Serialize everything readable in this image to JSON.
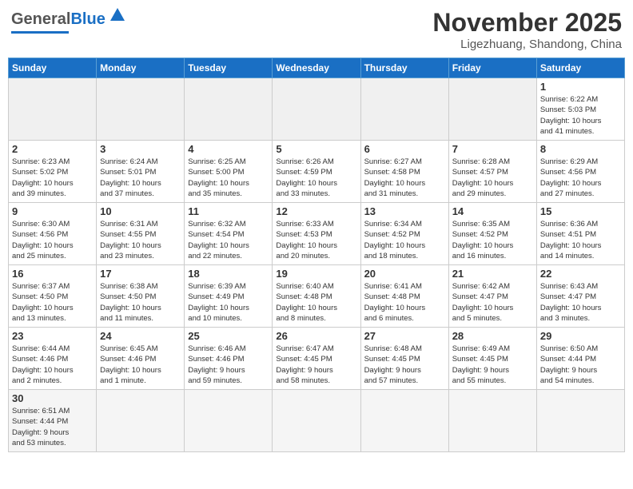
{
  "logo": {
    "text1": "General",
    "text2": "Blue"
  },
  "title": "November 2025",
  "location": "Ligezhuang, Shandong, China",
  "weekdays": [
    "Sunday",
    "Monday",
    "Tuesday",
    "Wednesday",
    "Thursday",
    "Friday",
    "Saturday"
  ],
  "days": [
    {
      "number": "",
      "info": "",
      "empty": true
    },
    {
      "number": "",
      "info": "",
      "empty": true
    },
    {
      "number": "",
      "info": "",
      "empty": true
    },
    {
      "number": "",
      "info": "",
      "empty": true
    },
    {
      "number": "",
      "info": "",
      "empty": true
    },
    {
      "number": "",
      "info": "",
      "empty": true
    },
    {
      "number": "1",
      "info": "Sunrise: 6:22 AM\nSunset: 5:03 PM\nDaylight: 10 hours\nand 41 minutes.",
      "empty": false
    }
  ],
  "week2": [
    {
      "number": "2",
      "info": "Sunrise: 6:23 AM\nSunset: 5:02 PM\nDaylight: 10 hours\nand 39 minutes."
    },
    {
      "number": "3",
      "info": "Sunrise: 6:24 AM\nSunset: 5:01 PM\nDaylight: 10 hours\nand 37 minutes."
    },
    {
      "number": "4",
      "info": "Sunrise: 6:25 AM\nSunset: 5:00 PM\nDaylight: 10 hours\nand 35 minutes."
    },
    {
      "number": "5",
      "info": "Sunrise: 6:26 AM\nSunset: 4:59 PM\nDaylight: 10 hours\nand 33 minutes."
    },
    {
      "number": "6",
      "info": "Sunrise: 6:27 AM\nSunset: 4:58 PM\nDaylight: 10 hours\nand 31 minutes."
    },
    {
      "number": "7",
      "info": "Sunrise: 6:28 AM\nSunset: 4:57 PM\nDaylight: 10 hours\nand 29 minutes."
    },
    {
      "number": "8",
      "info": "Sunrise: 6:29 AM\nSunset: 4:56 PM\nDaylight: 10 hours\nand 27 minutes."
    }
  ],
  "week3": [
    {
      "number": "9",
      "info": "Sunrise: 6:30 AM\nSunset: 4:56 PM\nDaylight: 10 hours\nand 25 minutes."
    },
    {
      "number": "10",
      "info": "Sunrise: 6:31 AM\nSunset: 4:55 PM\nDaylight: 10 hours\nand 23 minutes."
    },
    {
      "number": "11",
      "info": "Sunrise: 6:32 AM\nSunset: 4:54 PM\nDaylight: 10 hours\nand 22 minutes."
    },
    {
      "number": "12",
      "info": "Sunrise: 6:33 AM\nSunset: 4:53 PM\nDaylight: 10 hours\nand 20 minutes."
    },
    {
      "number": "13",
      "info": "Sunrise: 6:34 AM\nSunset: 4:52 PM\nDaylight: 10 hours\nand 18 minutes."
    },
    {
      "number": "14",
      "info": "Sunrise: 6:35 AM\nSunset: 4:52 PM\nDaylight: 10 hours\nand 16 minutes."
    },
    {
      "number": "15",
      "info": "Sunrise: 6:36 AM\nSunset: 4:51 PM\nDaylight: 10 hours\nand 14 minutes."
    }
  ],
  "week4": [
    {
      "number": "16",
      "info": "Sunrise: 6:37 AM\nSunset: 4:50 PM\nDaylight: 10 hours\nand 13 minutes."
    },
    {
      "number": "17",
      "info": "Sunrise: 6:38 AM\nSunset: 4:50 PM\nDaylight: 10 hours\nand 11 minutes."
    },
    {
      "number": "18",
      "info": "Sunrise: 6:39 AM\nSunset: 4:49 PM\nDaylight: 10 hours\nand 10 minutes."
    },
    {
      "number": "19",
      "info": "Sunrise: 6:40 AM\nSunset: 4:48 PM\nDaylight: 10 hours\nand 8 minutes."
    },
    {
      "number": "20",
      "info": "Sunrise: 6:41 AM\nSunset: 4:48 PM\nDaylight: 10 hours\nand 6 minutes."
    },
    {
      "number": "21",
      "info": "Sunrise: 6:42 AM\nSunset: 4:47 PM\nDaylight: 10 hours\nand 5 minutes."
    },
    {
      "number": "22",
      "info": "Sunrise: 6:43 AM\nSunset: 4:47 PM\nDaylight: 10 hours\nand 3 minutes."
    }
  ],
  "week5": [
    {
      "number": "23",
      "info": "Sunrise: 6:44 AM\nSunset: 4:46 PM\nDaylight: 10 hours\nand 2 minutes."
    },
    {
      "number": "24",
      "info": "Sunrise: 6:45 AM\nSunset: 4:46 PM\nDaylight: 10 hours\nand 1 minute."
    },
    {
      "number": "25",
      "info": "Sunrise: 6:46 AM\nSunset: 4:46 PM\nDaylight: 9 hours\nand 59 minutes."
    },
    {
      "number": "26",
      "info": "Sunrise: 6:47 AM\nSunset: 4:45 PM\nDaylight: 9 hours\nand 58 minutes."
    },
    {
      "number": "27",
      "info": "Sunrise: 6:48 AM\nSunset: 4:45 PM\nDaylight: 9 hours\nand 57 minutes."
    },
    {
      "number": "28",
      "info": "Sunrise: 6:49 AM\nSunset: 4:45 PM\nDaylight: 9 hours\nand 55 minutes."
    },
    {
      "number": "29",
      "info": "Sunrise: 6:50 AM\nSunset: 4:44 PM\nDaylight: 9 hours\nand 54 minutes."
    }
  ],
  "week6": [
    {
      "number": "30",
      "info": "Sunrise: 6:51 AM\nSunset: 4:44 PM\nDaylight: 9 hours\nand 53 minutes."
    },
    {
      "number": "",
      "info": "",
      "empty": true
    },
    {
      "number": "",
      "info": "",
      "empty": true
    },
    {
      "number": "",
      "info": "",
      "empty": true
    },
    {
      "number": "",
      "info": "",
      "empty": true
    },
    {
      "number": "",
      "info": "",
      "empty": true
    },
    {
      "number": "",
      "info": "",
      "empty": true
    }
  ]
}
